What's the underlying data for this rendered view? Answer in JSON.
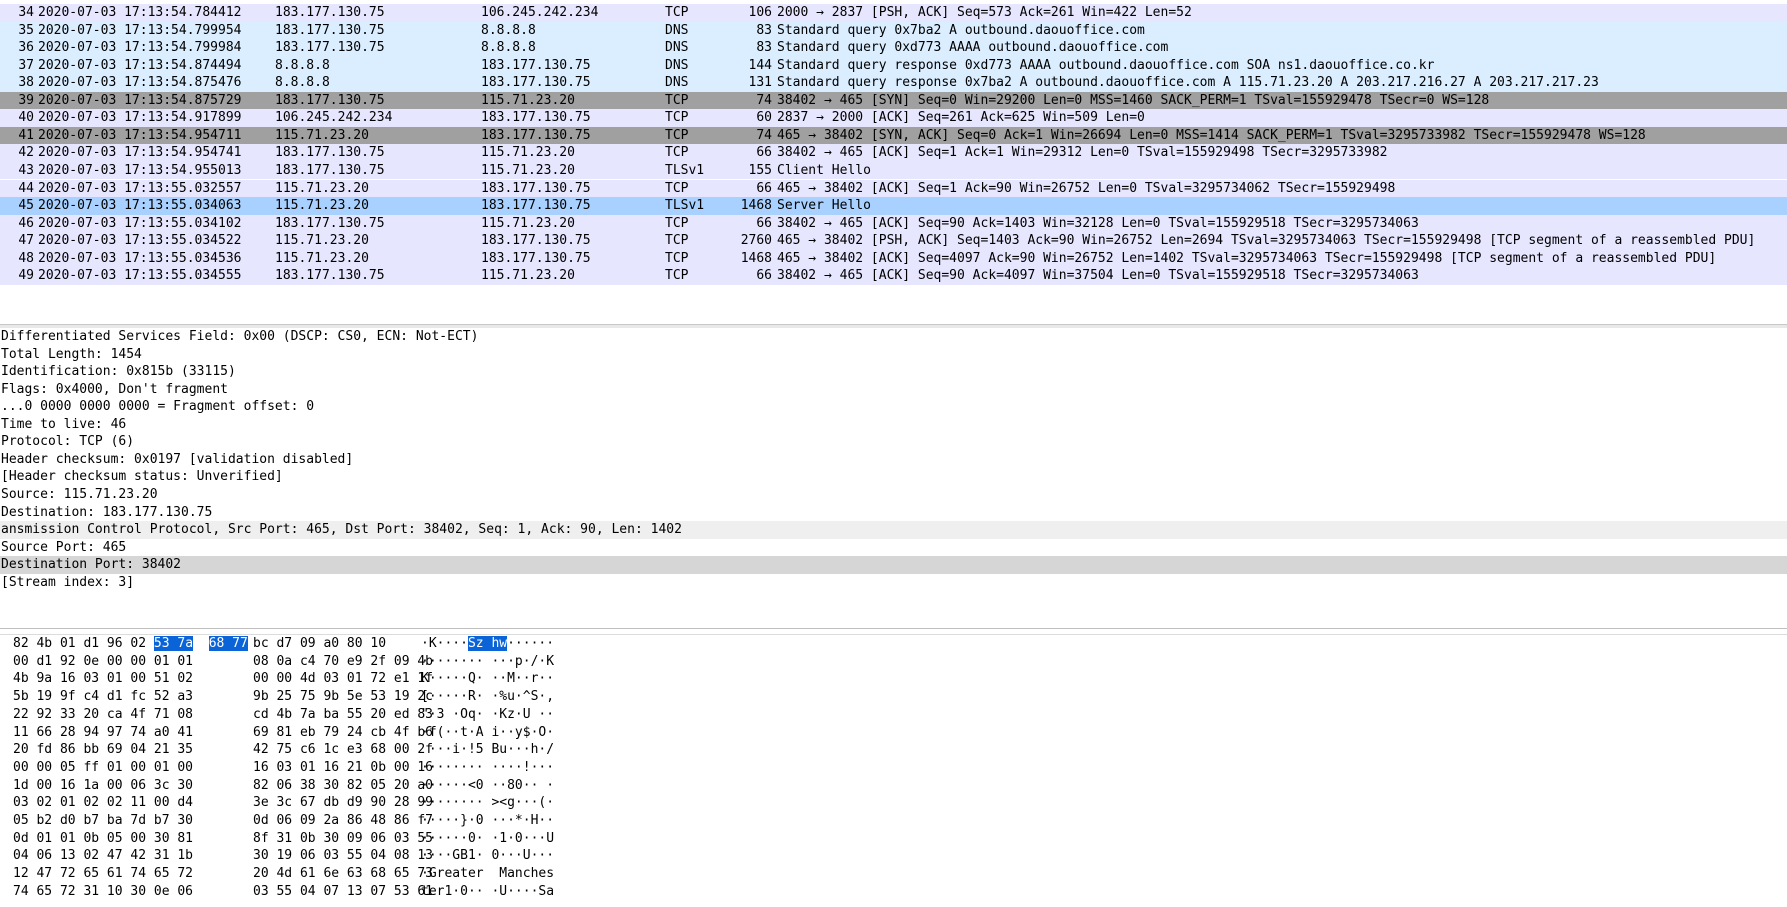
{
  "packets": [
    {
      "no": "34",
      "time": "2020-07-03 17:13:54.784412",
      "src": "183.177.130.75",
      "dst": "106.245.242.234",
      "proto": "TCP",
      "len": "106",
      "info": "2000 → 2837 [PSH, ACK] Seq=573 Ack=261 Win=422 Len=52",
      "color": "tcp"
    },
    {
      "no": "35",
      "time": "2020-07-03 17:13:54.799954",
      "src": "183.177.130.75",
      "dst": "8.8.8.8",
      "proto": "DNS",
      "len": "83",
      "info": "Standard query 0x7ba2 A outbound.daouoffice.com",
      "color": "dns"
    },
    {
      "no": "36",
      "time": "2020-07-03 17:13:54.799984",
      "src": "183.177.130.75",
      "dst": "8.8.8.8",
      "proto": "DNS",
      "len": "83",
      "info": "Standard query 0xd773 AAAA outbound.daouoffice.com",
      "color": "dns"
    },
    {
      "no": "37",
      "time": "2020-07-03 17:13:54.874494",
      "src": "8.8.8.8",
      "dst": "183.177.130.75",
      "proto": "DNS",
      "len": "144",
      "info": "Standard query response 0xd773 AAAA outbound.daouoffice.com SOA ns1.daouoffice.co.kr",
      "color": "dns"
    },
    {
      "no": "38",
      "time": "2020-07-03 17:13:54.875476",
      "src": "8.8.8.8",
      "dst": "183.177.130.75",
      "proto": "DNS",
      "len": "131",
      "info": "Standard query response 0x7ba2 A outbound.daouoffice.com A 115.71.23.20 A 203.217.216.27 A 203.217.217.23",
      "color": "dns"
    },
    {
      "no": "39",
      "time": "2020-07-03 17:13:54.875729",
      "src": "183.177.130.75",
      "dst": "115.71.23.20",
      "proto": "TCP",
      "len": "74",
      "info": "38402 → 465 [SYN] Seq=0 Win=29200 Len=0 MSS=1460 SACK_PERM=1 TSval=155929478 TSecr=0 WS=128",
      "color": "syn"
    },
    {
      "no": "40",
      "time": "2020-07-03 17:13:54.917899",
      "src": "106.245.242.234",
      "dst": "183.177.130.75",
      "proto": "TCP",
      "len": "60",
      "info": "2837 → 2000 [ACK] Seq=261 Ack=625 Win=509 Len=0",
      "color": "tcp"
    },
    {
      "no": "41",
      "time": "2020-07-03 17:13:54.954711",
      "src": "115.71.23.20",
      "dst": "183.177.130.75",
      "proto": "TCP",
      "len": "74",
      "info": "465 → 38402 [SYN, ACK] Seq=0 Ack=1 Win=26694 Len=0 MSS=1414 SACK_PERM=1 TSval=3295733982 TSecr=155929478 WS=128",
      "color": "syn"
    },
    {
      "no": "42",
      "time": "2020-07-03 17:13:54.954741",
      "src": "183.177.130.75",
      "dst": "115.71.23.20",
      "proto": "TCP",
      "len": "66",
      "info": "38402 → 465 [ACK] Seq=1 Ack=1 Win=29312 Len=0 TSval=155929498 TSecr=3295733982",
      "color": "tcp"
    },
    {
      "no": "43",
      "time": "2020-07-03 17:13:54.955013",
      "src": "183.177.130.75",
      "dst": "115.71.23.20",
      "proto": "TLSv1",
      "len": "155",
      "info": "Client Hello",
      "color": "tcp"
    },
    {
      "no": "44",
      "time": "2020-07-03 17:13:55.032557",
      "src": "115.71.23.20",
      "dst": "183.177.130.75",
      "proto": "TCP",
      "len": "66",
      "info": "465 → 38402 [ACK] Seq=1 Ack=90 Win=26752 Len=0 TSval=3295734062 TSecr=155929498",
      "color": "tcp"
    },
    {
      "no": "45",
      "time": "2020-07-03 17:13:55.034063",
      "src": "115.71.23.20",
      "dst": "183.177.130.75",
      "proto": "TLSv1",
      "len": "1468",
      "info": "Server Hello",
      "color": "selected"
    },
    {
      "no": "46",
      "time": "2020-07-03 17:13:55.034102",
      "src": "183.177.130.75",
      "dst": "115.71.23.20",
      "proto": "TCP",
      "len": "66",
      "info": "38402 → 465 [ACK] Seq=90 Ack=1403 Win=32128 Len=0 TSval=155929518 TSecr=3295734063",
      "color": "tcp"
    },
    {
      "no": "47",
      "time": "2020-07-03 17:13:55.034522",
      "src": "115.71.23.20",
      "dst": "183.177.130.75",
      "proto": "TCP",
      "len": "2760",
      "info": "465 → 38402 [PSH, ACK] Seq=1403 Ack=90 Win=26752 Len=2694 TSval=3295734063 TSecr=155929498 [TCP segment of a reassembled PDU]",
      "color": "tcp"
    },
    {
      "no": "48",
      "time": "2020-07-03 17:13:55.034536",
      "src": "115.71.23.20",
      "dst": "183.177.130.75",
      "proto": "TCP",
      "len": "1468",
      "info": "465 → 38402 [ACK] Seq=4097 Ack=90 Win=26752 Len=1402 TSval=3295734063 TSecr=155929498 [TCP segment of a reassembled PDU]",
      "color": "tcp"
    },
    {
      "no": "49",
      "time": "2020-07-03 17:13:55.034555",
      "src": "183.177.130.75",
      "dst": "115.71.23.20",
      "proto": "TCP",
      "len": "66",
      "info": "38402 → 465 [ACK] Seq=90 Ack=4097 Win=37504 Len=0 TSval=155929518 TSecr=3295734063",
      "color": "tcp"
    }
  ],
  "details": [
    {
      "text": "Differentiated Services Field: 0x00 (DSCP: CS0, ECN: Not-ECT)",
      "kind": "field"
    },
    {
      "text": "Total Length: 1454",
      "kind": "field"
    },
    {
      "text": "Identification: 0x815b (33115)",
      "kind": "field"
    },
    {
      "text": "Flags: 0x4000, Don't fragment",
      "kind": "field"
    },
    {
      "text": "...0 0000 0000 0000 = Fragment offset: 0",
      "kind": "field"
    },
    {
      "text": "Time to live: 46",
      "kind": "field"
    },
    {
      "text": "Protocol: TCP (6)",
      "kind": "field"
    },
    {
      "text": "Header checksum: 0x0197 [validation disabled]",
      "kind": "field"
    },
    {
      "text": "[Header checksum status: Unverified]",
      "kind": "field"
    },
    {
      "text": "Source: 115.71.23.20",
      "kind": "field"
    },
    {
      "text": "Destination: 183.177.130.75",
      "kind": "field"
    },
    {
      "text": "ansmission Control Protocol, Src Port: 465, Dst Port: 38402, Seq: 1, Ack: 90, Len: 1402",
      "kind": "proto"
    },
    {
      "text": "Source Port: 465",
      "kind": "field"
    },
    {
      "text": "Destination Port: 38402",
      "kind": "selected"
    },
    {
      "text": "[Stream index: 3]",
      "kind": "field"
    }
  ],
  "bytes": [
    {
      "pre": "82 4b 01 d1 96 02 ",
      "hl1": "53 7a",
      "mid": "  ",
      "hl2": "68 77",
      "right": "bc d7 09 a0 80 10",
      "ascii_pre": "·K····",
      "ascii_hl": "Sz hw",
      "ascii_post": "······"
    },
    {
      "pre": "00 d1 92 0e 00 00 01 01",
      "hl1": "",
      "mid": "",
      "hl2": "",
      "right": "08 0a c4 70 e9 2f 09 4b",
      "ascii_pre": "········ ···p·/·K",
      "ascii_hl": "",
      "ascii_post": ""
    },
    {
      "pre": "4b 9a 16 03 01 00 51 02",
      "hl1": "",
      "mid": "",
      "hl2": "",
      "right": "00 00 4d 03 01 72 e1 1f",
      "ascii_pre": "K·····Q· ··M··r··",
      "ascii_hl": "",
      "ascii_post": ""
    },
    {
      "pre": "5b 19 9f c4 d1 fc 52 a3",
      "hl1": "",
      "mid": "",
      "hl2": "",
      "right": "9b 25 75 9b 5e 53 19 2c",
      "ascii_pre": "[·····R· ·%u·^S·,",
      "ascii_hl": "",
      "ascii_post": ""
    },
    {
      "pre": "22 92 33 20 ca 4f 71 08",
      "hl1": "",
      "mid": "",
      "hl2": "",
      "right": "cd 4b 7a ba 55 20 ed 83",
      "ascii_pre": "\"·3 ·Oq· ·Kz·U ··",
      "ascii_hl": "",
      "ascii_post": ""
    },
    {
      "pre": "11 66 28 94 97 74 a0 41",
      "hl1": "",
      "mid": "",
      "hl2": "",
      "right": "69 81 eb 79 24 cb 4f b6",
      "ascii_pre": "·f(··t·A i··y$·O·",
      "ascii_hl": "",
      "ascii_post": ""
    },
    {
      "pre": "20 fd 86 bb 69 04 21 35",
      "hl1": "",
      "mid": "",
      "hl2": "",
      "right": "42 75 c6 1c e3 68 00 2f",
      "ascii_pre": " ···i·!5 Bu···h·/",
      "ascii_hl": "",
      "ascii_post": ""
    },
    {
      "pre": "00 00 05 ff 01 00 01 00",
      "hl1": "",
      "mid": "",
      "hl2": "",
      "right": "16 03 01 16 21 0b 00 16",
      "ascii_pre": "········ ····!···",
      "ascii_hl": "",
      "ascii_post": ""
    },
    {
      "pre": "1d 00 16 1a 00 06 3c 30",
      "hl1": "",
      "mid": "",
      "hl2": "",
      "right": "82 06 38 30 82 05 20 a0",
      "ascii_pre": "······<0 ··80·· ·",
      "ascii_hl": "",
      "ascii_post": ""
    },
    {
      "pre": "03 02 01 02 02 11 00 d4",
      "hl1": "",
      "mid": "",
      "hl2": "",
      "right": "3e 3c 67 db d9 90 28 99",
      "ascii_pre": "········ ><g···(·",
      "ascii_hl": "",
      "ascii_post": ""
    },
    {
      "pre": "05 b2 d0 b7 ba 7d b7 30",
      "hl1": "",
      "mid": "",
      "hl2": "",
      "right": "0d 06 09 2a 86 48 86 f7",
      "ascii_pre": "·····}·0 ···*·H··",
      "ascii_hl": "",
      "ascii_post": ""
    },
    {
      "pre": "0d 01 01 0b 05 00 30 81",
      "hl1": "",
      "mid": "",
      "hl2": "",
      "right": "8f 31 0b 30 09 06 03 55",
      "ascii_pre": "······0· ·1·0···U",
      "ascii_hl": "",
      "ascii_post": ""
    },
    {
      "pre": "04 06 13 02 47 42 31 1b",
      "hl1": "",
      "mid": "",
      "hl2": "",
      "right": "30 19 06 03 55 04 08 13",
      "ascii_pre": "····GB1· 0···U···",
      "ascii_hl": "",
      "ascii_post": ""
    },
    {
      "pre": "12 47 72 65 61 74 65 72",
      "hl1": "",
      "mid": "",
      "hl2": "",
      "right": "20 4d 61 6e 63 68 65 73",
      "ascii_pre": "·Greater  Manches",
      "ascii_hl": "",
      "ascii_post": ""
    },
    {
      "pre": "74 65 72 31 10 30 0e 06",
      "hl1": "",
      "mid": "",
      "hl2": "",
      "right": "03 55 04 07 13 07 53 61",
      "ascii_pre": "ter1·0·· ·U····Sa",
      "ascii_hl": "",
      "ascii_post": ""
    }
  ],
  "colors": {
    "tcp": "#e7e6ff",
    "dns": "#daeeff",
    "syn": "#a0a0a0",
    "selected": "#a8d1ff",
    "byte_highlight": "#0a64d8"
  }
}
